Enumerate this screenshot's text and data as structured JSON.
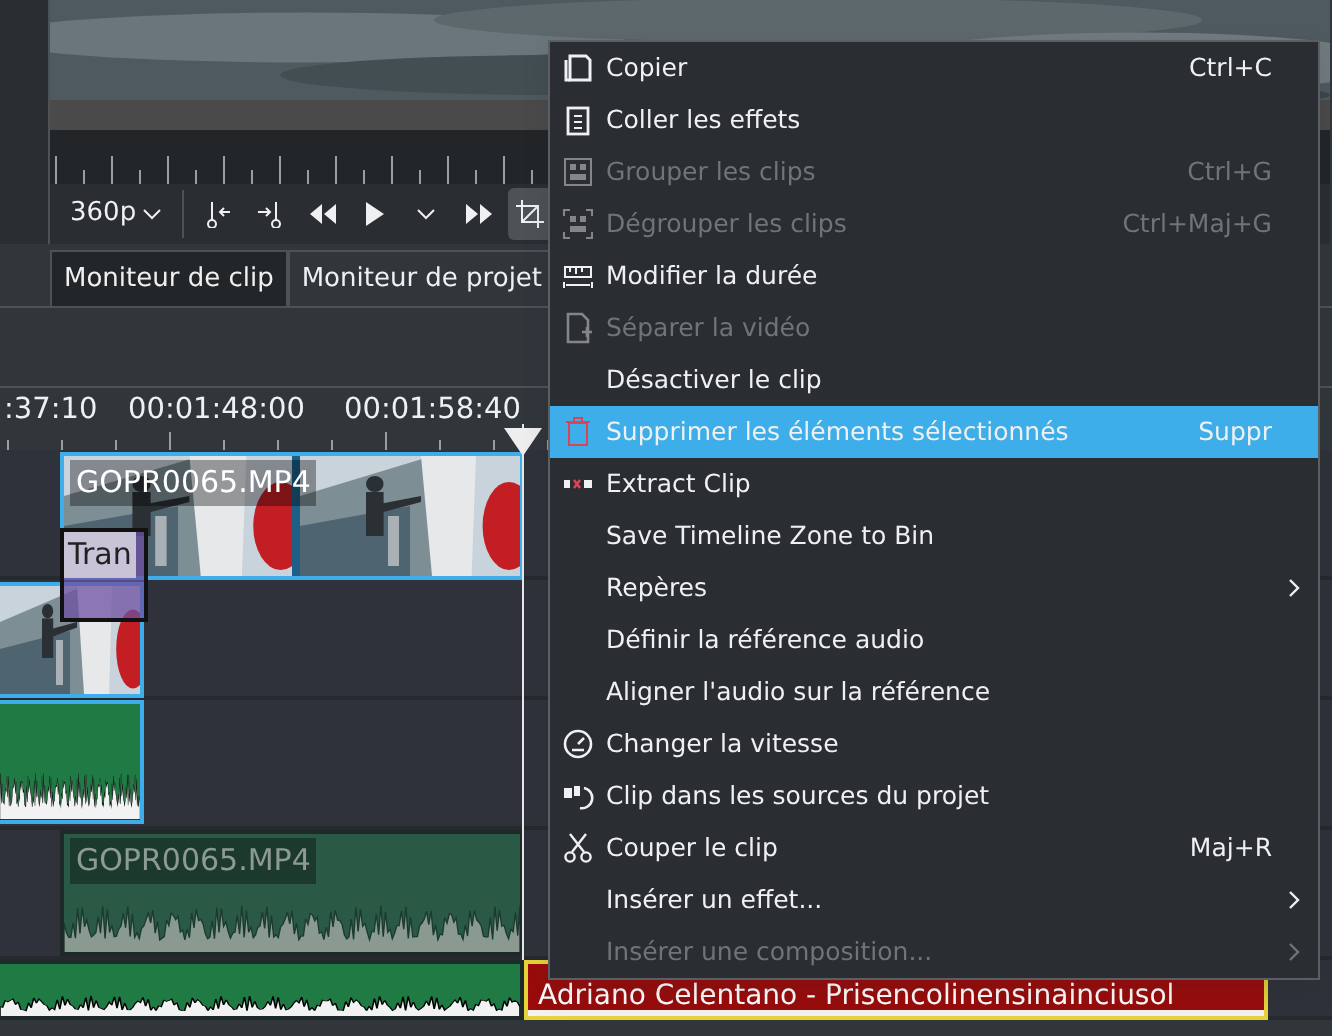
{
  "monitor": {
    "resolution": "360p",
    "tabs": [
      {
        "label": "Moniteur de clip",
        "selected": true
      },
      {
        "label": "Moniteur de projet",
        "selected": false
      }
    ]
  },
  "timeline": {
    "timecodes": [
      ":37:10",
      "00:01:48:00",
      "00:01:58:40"
    ],
    "clips": [
      {
        "kind": "video",
        "label": "GOPR0065.MP4",
        "selected": true
      },
      {
        "kind": "transition",
        "label": "Tran",
        "selected": false
      },
      {
        "kind": "video",
        "selected": true
      },
      {
        "kind": "audio",
        "selected": true
      },
      {
        "kind": "audio",
        "label": "GOPR0065.MP4",
        "selected": false,
        "disabled": true
      },
      {
        "kind": "audio",
        "selected": false
      },
      {
        "kind": "music",
        "label": "Adriano Celentano - Prisencolinensinainciusol",
        "selected": true
      }
    ]
  },
  "context_menu": {
    "items": [
      {
        "label": "Copier",
        "shortcut": "Ctrl+C",
        "disabled": false,
        "selected": false
      },
      {
        "label": "Coller les effets",
        "disabled": false,
        "selected": false
      },
      {
        "label": "Grouper les clips",
        "shortcut": "Ctrl+G",
        "disabled": true,
        "selected": false
      },
      {
        "label": "Dégrouper les clips",
        "shortcut": "Ctrl+Maj+G",
        "disabled": true,
        "selected": false
      },
      {
        "label": "Modifier la durée",
        "disabled": false,
        "selected": false
      },
      {
        "label": "Séparer la vidéo",
        "disabled": true,
        "selected": false
      },
      {
        "label": "Désactiver le clip",
        "disabled": false,
        "selected": false
      },
      {
        "label": "Supprimer les éléments sélectionnés",
        "shortcut": "Suppr",
        "disabled": false,
        "selected": true
      },
      {
        "label": "Extract Clip",
        "disabled": false,
        "selected": false
      },
      {
        "label": "Save Timeline Zone to Bin",
        "disabled": false,
        "selected": false
      },
      {
        "label": "Repères",
        "submenu": true,
        "disabled": false,
        "selected": false
      },
      {
        "label": "Définir la référence audio",
        "disabled": false,
        "selected": false
      },
      {
        "label": "Aligner l'audio sur la référence",
        "disabled": false,
        "selected": false
      },
      {
        "label": "Changer la vitesse",
        "disabled": false,
        "selected": false
      },
      {
        "label": "Clip dans les sources du projet",
        "disabled": false,
        "selected": false
      },
      {
        "label": "Couper le clip",
        "shortcut": "Maj+R",
        "disabled": false,
        "selected": false
      },
      {
        "label": "Insérer un effet...",
        "submenu": true,
        "disabled": false,
        "selected": false
      },
      {
        "label": "Insérer une composition...",
        "submenu": true,
        "disabled": true,
        "selected": false
      }
    ]
  }
}
